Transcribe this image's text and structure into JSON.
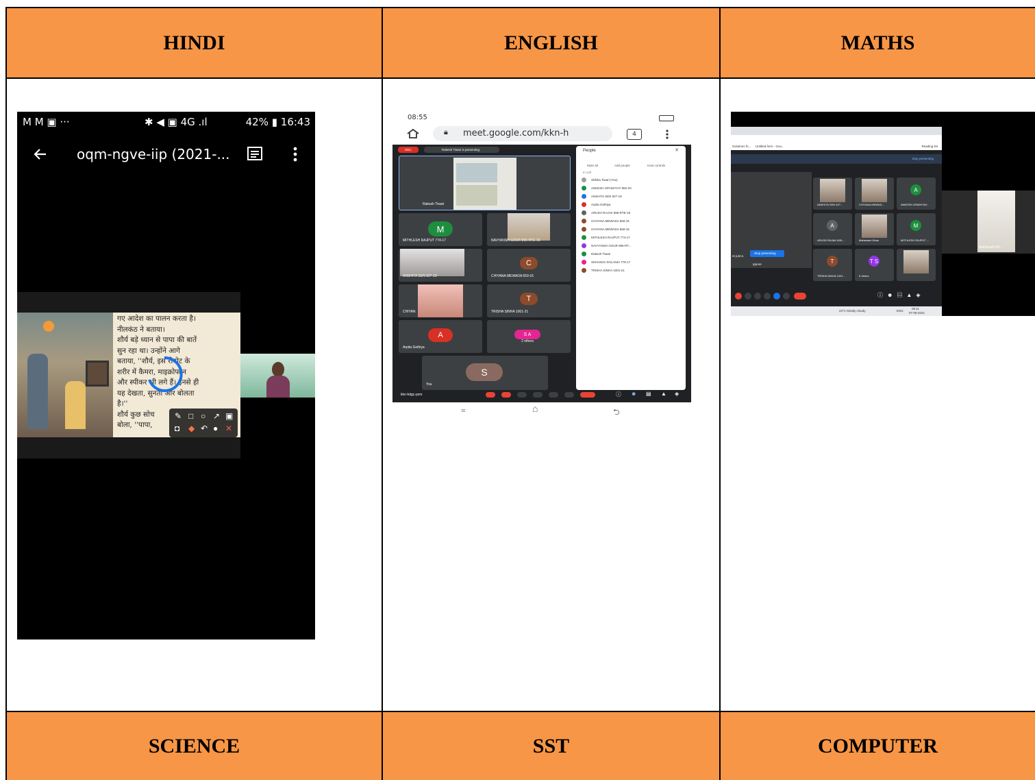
{
  "table": {
    "headers_top": [
      "HINDI",
      "ENGLISH",
      "MATHS"
    ],
    "headers_bottom": [
      "SCIENCE",
      "SST",
      "COMPUTER"
    ],
    "header_color": "#f79646"
  },
  "hindi_shot": {
    "status_left": "M M ▣ ···",
    "status_right": "42% ▮ 16:43",
    "status_icons": "✱ ◀ ▣ 4G .ıl",
    "meeting_title": "oqm-ngve-iip (2021-...",
    "book_text": [
      "गए आदेश का पालन करता है।",
      "नीलकंठ ने बताया।",
      "शौर्य बड़े ध्यान से पापा की बातें",
      "सुन रहा था। उन्होंने आगे",
      "बताया, ''शौर्य, इस रोबोट के",
      "शरीर में कैमरा, माइक्रोफोन",
      "और स्पीकर भी लगे हैं। इनसे ही",
      "यह देखता, सुनता और बोलता",
      "है।''",
      "शौर्य कुछ सोच",
      "बोला, ''पापा,"
    ]
  },
  "english_shot": {
    "status_time": "08:55",
    "url": "meet.google.com/kkn-h",
    "tab_count": "4",
    "rec_label": "REC",
    "presenting": "Rakesh Tiwari is presenting",
    "presenter_tile": "Rakesh Tiwari",
    "tiles": [
      {
        "name": "MITHLESH RAJPUT 774-17",
        "letter": "M",
        "color": "#1e8e3e"
      },
      {
        "name": "NAVYANSH GOUR 895-RTE-16",
        "letter": "",
        "color": ""
      },
      {
        "name": "ANSHITA SEN 927-19",
        "letter": "",
        "color": ""
      },
      {
        "name": "CHIYANA MEWADA 659-16",
        "letter": "C",
        "color": "#8d4b2b"
      },
      {
        "name": "CHIYAN",
        "letter": "",
        "color": ""
      },
      {
        "name": "TRISHA SINHA 1001-21",
        "letter": "T",
        "color": "#8d4b2b"
      },
      {
        "name": "Arpita Gethiya",
        "letter": "A",
        "color": "#d93025"
      },
      {
        "name": "2 others",
        "letter": "S A",
        "color": "#e52592"
      }
    ],
    "you_tile": {
      "name": "You",
      "letter": "S"
    },
    "meeting_code": "kkn-hdgc-pxm",
    "people_panel": {
      "title": "People",
      "actions": [
        "Mute all",
        "Add people",
        "Host controls"
      ],
      "section": "In call",
      "people": [
        {
          "name": "Shikha Tiwari (You)",
          "color": "#9e9e9e"
        },
        {
          "name": "ANKESH UPADHYAY 982-20",
          "color": "#1e8e3e"
        },
        {
          "name": "ANSHITA SEN 927-19",
          "color": "#1a73e8"
        },
        {
          "name": "Arpita Gethiya",
          "color": "#d93025"
        },
        {
          "name": "ARUSH RAJAK 895-RTE-18",
          "color": "#5f6368"
        },
        {
          "name": "CHIYANA MEWADA 659-16",
          "color": "#8d4b2b"
        },
        {
          "name": "CHIYANA MEWADA 659-16",
          "color": "#8d4b2b"
        },
        {
          "name": "MITHLESH RAJPUT 774-17",
          "color": "#1e8e3e"
        },
        {
          "name": "NAVYANSH GOUR 895-RT...",
          "color": "#9334e6"
        },
        {
          "name": "Rakesh Tiwari",
          "color": "#1e8e3e"
        },
        {
          "name": "SHIVANGI SOLANKI 779-17",
          "color": "#e52592"
        },
        {
          "name": "TRISHA SINHA 1001-21",
          "color": "#8d4b2b"
        }
      ]
    }
  },
  "maths_shot": {
    "bookmark1": "Solutions fo...",
    "bookmark2": "Untitled form - Goo...",
    "reading_list": "Reading list",
    "stop_presenting": "Stop presenting",
    "notice_text": "re just a",
    "ignore": "Ignore",
    "tiles": [
      {
        "name": "ANSHITA SEN 927...",
        "letter": "",
        "color": ""
      },
      {
        "name": "CHIYANA MEWAD...",
        "letter": "",
        "color": ""
      },
      {
        "name": "ANKESH UPADHYAY...",
        "letter": "A",
        "color": "#1e8e3e"
      },
      {
        "name": "ARUSH RAJAK 895-...",
        "letter": "A",
        "color": "#5f6368"
      },
      {
        "name": "Mahavash Khan",
        "letter": "",
        "color": ""
      },
      {
        "name": "MITHLESH RAJPUT ...",
        "letter": "M",
        "color": "#1e8e3e"
      },
      {
        "name": "TRISHA SINHA 1001...",
        "letter": "T",
        "color": "#8d4b2b"
      },
      {
        "name": "6 others",
        "letter": "T S",
        "color": "#9334e6"
      },
      {
        "name": "",
        "letter": "",
        "color": ""
      }
    ],
    "side_tile": "Mahavash Kh...",
    "weather": "23°C Mostly cloudy",
    "lang": "ENG",
    "clock": "09:11",
    "date": "07-08-2021"
  }
}
